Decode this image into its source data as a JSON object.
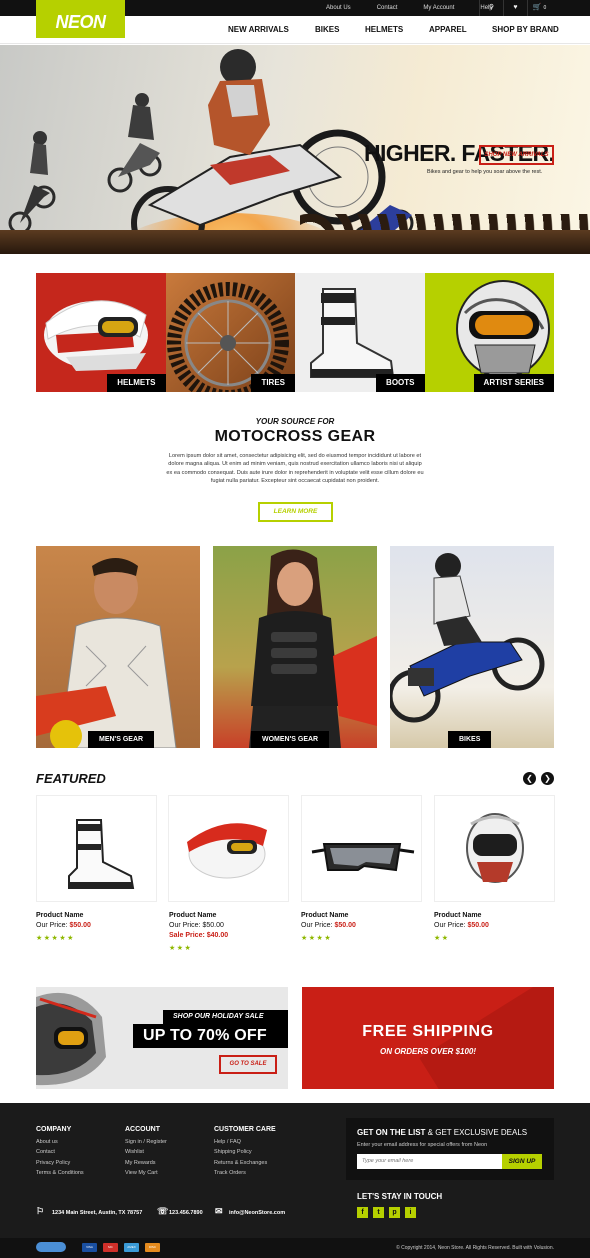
{
  "topbar": {
    "links": [
      "About Us",
      "Contact",
      "My Account",
      "Help"
    ],
    "cart_count": "0"
  },
  "logo": "NEON",
  "nav": [
    "NEW ARRIVALS",
    "BIKES",
    "HELMETS",
    "APPAREL",
    "SHOP BY BRAND"
  ],
  "hero": {
    "title": "HIGHER. FASTER.",
    "subtitle": "Bikes and gear to help you soar above the rest.",
    "cta": "SHOP NEW ARRIVALS"
  },
  "categories": [
    {
      "label": "HELMETS",
      "bg": "#c5271c"
    },
    {
      "label": "TIRES",
      "bg": "#a05c27"
    },
    {
      "label": "BOOTS",
      "bg": "#eeeeee"
    },
    {
      "label": "ARTIST SERIES",
      "bg": "#b6d000"
    }
  ],
  "intro": {
    "sub": "YOUR SOURCE FOR",
    "title": "MOTOCROSS GEAR",
    "body": "Lorem ipsum dolor sit amet, consectetur adipisicing elit, sed do eiusmod tempor incididunt ut labore et dolore magna aliqua. Ut enim ad minim veniam, quis nostrud exercitation ullamco laboris nisi ut aliquip ex ea commodo consequat. Duis aute irure dolor in reprehenderit in voluptate velit esse cillum dolore eu fugiat nulla pariatur. Excepteur sint occaecat cupidatat non proident.",
    "cta": "LEARN MORE"
  },
  "gear": [
    {
      "label": "MEN'S GEAR"
    },
    {
      "label": "WOMEN'S GEAR"
    },
    {
      "label": "BIKES"
    }
  ],
  "featured": {
    "title": "FEATURED",
    "products": [
      {
        "name": "Product Name",
        "price_label": "Our Price:",
        "price": "$50.00",
        "sale": "",
        "stars": "★★★★★"
      },
      {
        "name": "Product Name",
        "price_label": "Our Price:",
        "price": "$50.00",
        "sale": "Sale Price: $40.00",
        "stars": "★★★"
      },
      {
        "name": "Product Name",
        "price_label": "Our Price:",
        "price": "$50.00",
        "sale": "",
        "stars": "★★★★"
      },
      {
        "name": "Product Name",
        "price_label": "Our Price:",
        "price": "$50.00",
        "sale": "",
        "stars": "★★"
      }
    ]
  },
  "promo": {
    "holiday_line1": "SHOP OUR HOLIDAY SALE",
    "holiday_line2": "UP TO 70% OFF",
    "holiday_cta": "GO TO SALE",
    "ship_line1": "FREE SHIPPING",
    "ship_line2": "ON ORDERS OVER $100!"
  },
  "footer": {
    "company": {
      "title": "COMPANY",
      "items": [
        "About us",
        "Contact",
        "Privacy Policy",
        "Terms & Conditions"
      ]
    },
    "account": {
      "title": "ACCOUNT",
      "items": [
        "Sign in / Register",
        "Wishlist",
        "My Rewards",
        "View My Cart"
      ]
    },
    "care": {
      "title": "CUSTOMER CARE",
      "items": [
        "Help / FAQ",
        "Shipping Policy",
        "Returns & Exchanges",
        "Track Orders"
      ]
    },
    "newsletter": {
      "title_bold": "GET ON THE LIST",
      "title_rest": " & GET EXCLUSIVE DEALS",
      "sub": "Enter your email address for special offers from Neon",
      "placeholder": "Type your email here",
      "button": "SIGN UP"
    },
    "touch": "LET'S STAY IN TOUCH",
    "social": [
      "f",
      "t",
      "p",
      "i"
    ],
    "address": "1234 Main Street, Austin, TX 78757",
    "phone": "123.456.7890",
    "email": "info@NeonStore.com",
    "copyright": "© Copyright 2014, Neon Store. All Rights Reserved. Built with Volusion.",
    "cards": [
      "VISA",
      "MC",
      "AMEX",
      "DISC"
    ]
  },
  "colors": {
    "accent": "#b6d000",
    "red": "#c91f16"
  }
}
